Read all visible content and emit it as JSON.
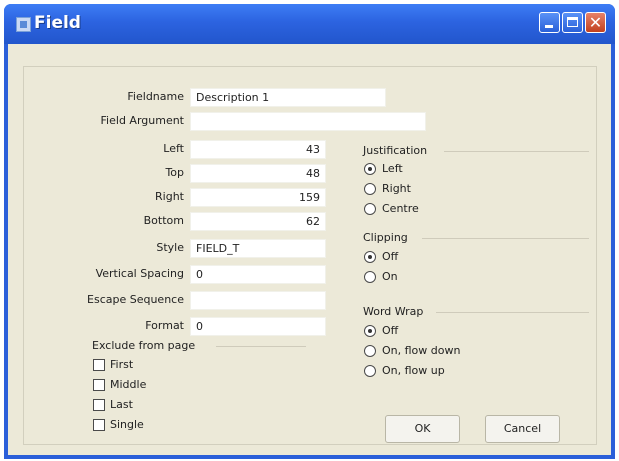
{
  "window": {
    "title": "Field"
  },
  "fields": {
    "fieldname": {
      "label": "Fieldname",
      "value": "Description 1"
    },
    "field_argument": {
      "label": "Field Argument",
      "value": ""
    },
    "left": {
      "label": "Left",
      "value": "43"
    },
    "top": {
      "label": "Top",
      "value": "48"
    },
    "right": {
      "label": "Right",
      "value": "159"
    },
    "bottom": {
      "label": "Bottom",
      "value": "62"
    },
    "style": {
      "label": "Style",
      "value": "FIELD_T"
    },
    "vertical_spacing": {
      "label": "Vertical Spacing",
      "value": "0"
    },
    "escape_sequence": {
      "label": "Escape Sequence",
      "value": ""
    },
    "format": {
      "label": "Format",
      "value": "0"
    }
  },
  "exclude": {
    "heading": "Exclude from page",
    "items": [
      {
        "label": "First",
        "checked": false
      },
      {
        "label": "Middle",
        "checked": false
      },
      {
        "label": "Last",
        "checked": false
      },
      {
        "label": "Single",
        "checked": false
      }
    ]
  },
  "justification": {
    "heading": "Justification",
    "options": [
      {
        "label": "Left",
        "selected": true
      },
      {
        "label": "Right",
        "selected": false
      },
      {
        "label": "Centre",
        "selected": false
      }
    ]
  },
  "clipping": {
    "heading": "Clipping",
    "options": [
      {
        "label": "Off",
        "selected": true
      },
      {
        "label": "On",
        "selected": false
      }
    ]
  },
  "word_wrap": {
    "heading": "Word Wrap",
    "options": [
      {
        "label": "Off",
        "selected": true
      },
      {
        "label": "On, flow down",
        "selected": false
      },
      {
        "label": "On, flow up",
        "selected": false
      }
    ]
  },
  "buttons": {
    "ok": "OK",
    "cancel": "Cancel"
  },
  "colors": {
    "titlebar": "#2b5fd9",
    "dialog_bg": "#ece9d8",
    "close_button": "#c2401e"
  }
}
